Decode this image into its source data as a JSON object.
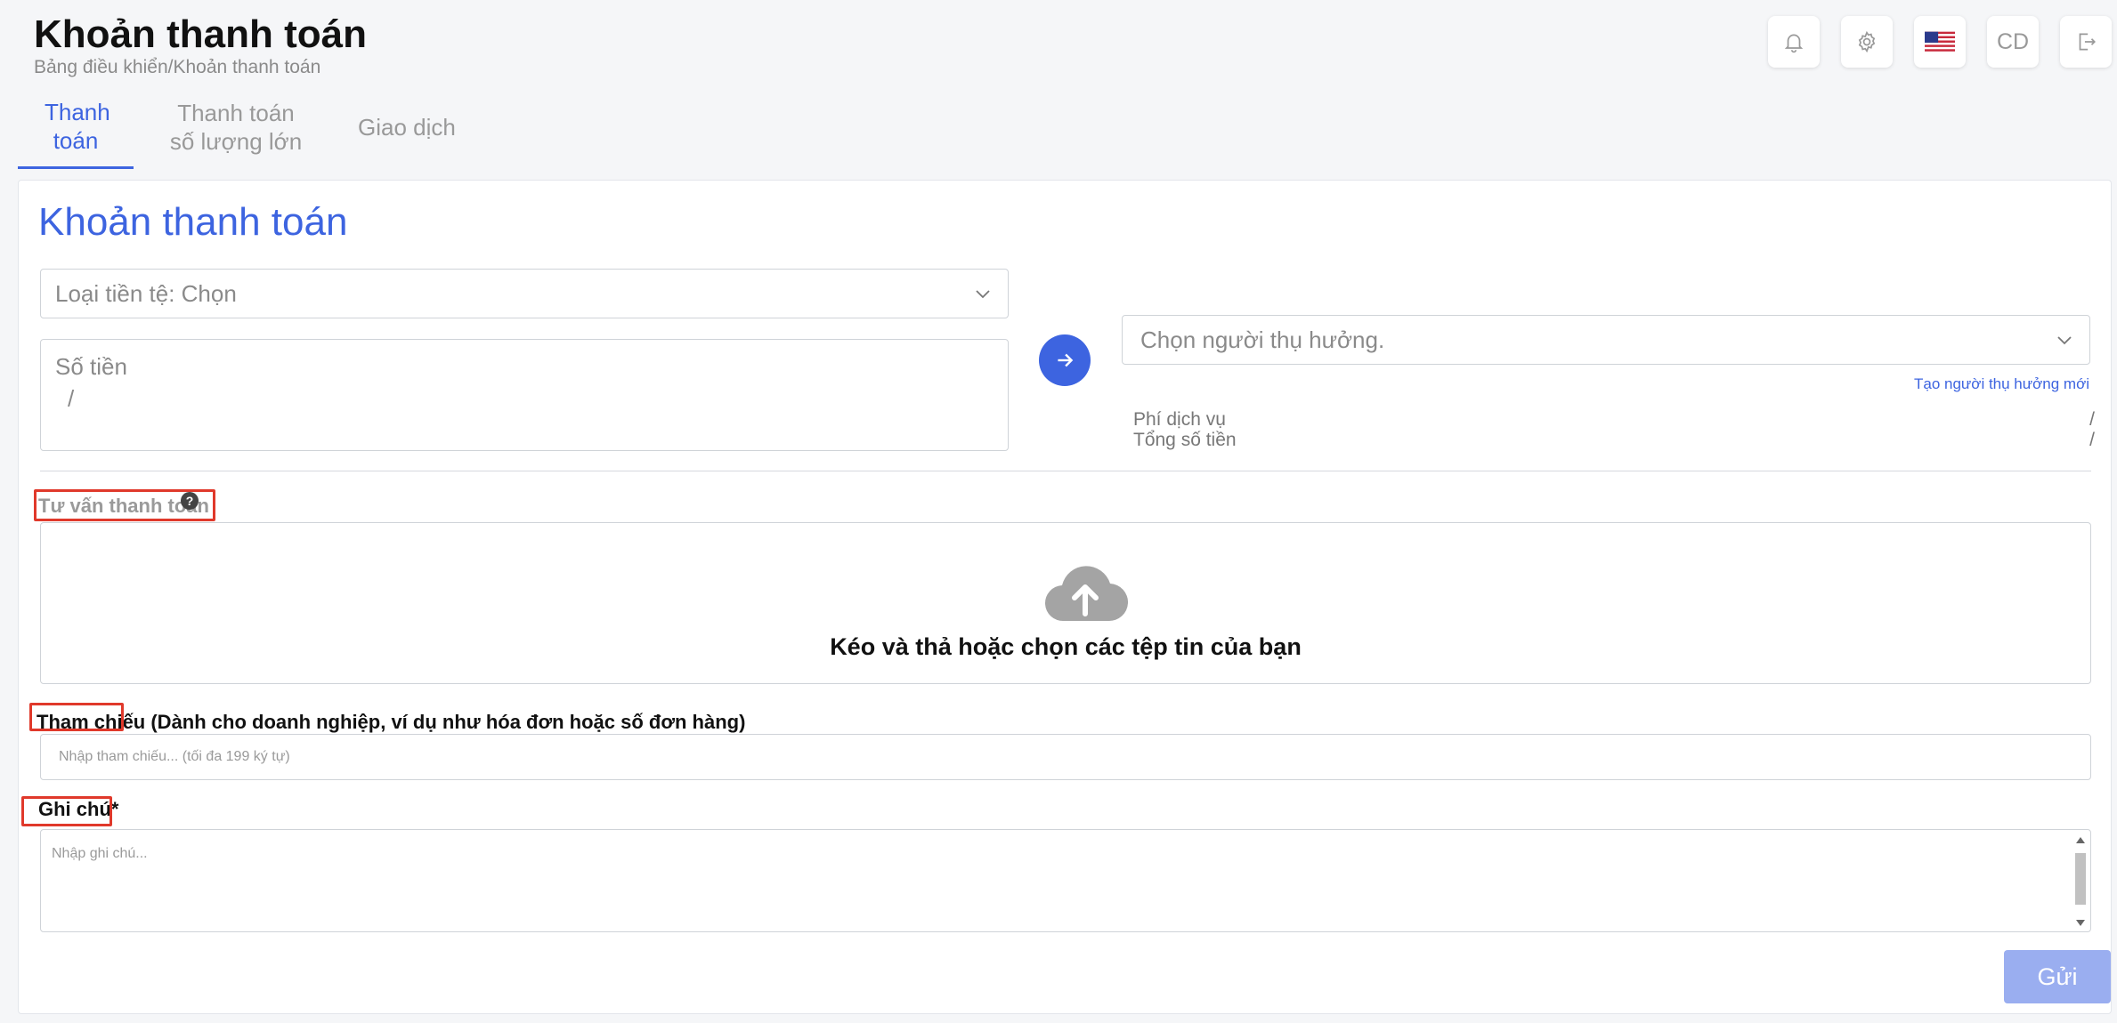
{
  "header": {
    "title": "Khoản thanh toán",
    "breadcrumb": "Bảng điều khiển/Khoản thanh toán",
    "user_initials": "CD",
    "icons": [
      "bell-icon",
      "gear-icon",
      "us-flag-icon",
      "logout-icon"
    ]
  },
  "tabs": [
    {
      "label": "Thanh toán",
      "active": true
    },
    {
      "label": "Thanh toán số lượng lớn",
      "active": false
    },
    {
      "label": "Giao dịch",
      "active": false
    }
  ],
  "form": {
    "title": "Khoản thanh toán",
    "currency_select": "Loại tiền tệ: Chọn",
    "amount_label": "Số tiền",
    "amount_value": "/",
    "beneficiary_placeholder": "Chọn người thụ hưởng.",
    "create_beneficiary": "Tạo người thụ hưởng mới",
    "service_fee_label": "Phí dịch vụ",
    "service_fee_value": "/",
    "total_label": "Tổng số tiền",
    "total_value": "/",
    "advice_label": "Tư vấn thanh toán",
    "advice_help": "?",
    "dropzone_text": "Kéo và thả hoặc chọn các tệp tin của bạn",
    "reference_label": "Tham chiếu (Dành cho doanh nghiệp, ví dụ như hóa đơn hoặc số đơn hàng)",
    "reference_placeholder": "Nhập tham chiếu... (tối đa 199 ký tự)",
    "note_label": "Ghi chú*",
    "note_placeholder": "Nhập ghi chú...",
    "submit_label": "Gửi"
  },
  "colors": {
    "accent": "#3d64e0",
    "submit_disabled": "#9aaef0",
    "highlight": "#e0392b"
  }
}
